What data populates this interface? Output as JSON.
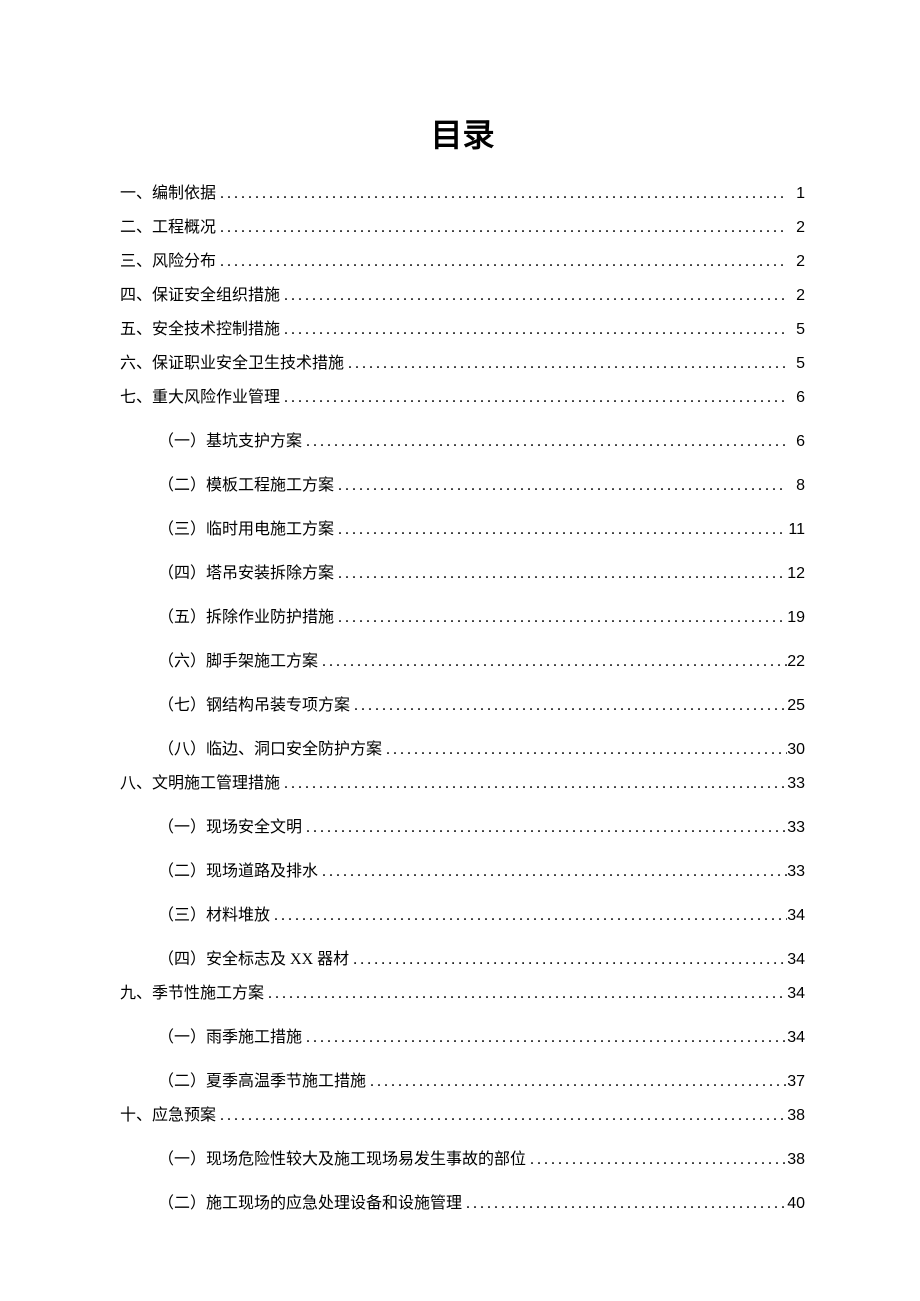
{
  "title": "目录",
  "toc": [
    {
      "level": 1,
      "num": "一、",
      "text": "编制依据",
      "page": "1"
    },
    {
      "level": 1,
      "num": "二、",
      "text": "工程概况",
      "page": "2"
    },
    {
      "level": 1,
      "num": "三、",
      "text": "风险分布",
      "page": "2"
    },
    {
      "level": 1,
      "num": "四、",
      "text": "保证安全组织措施",
      "page": "2"
    },
    {
      "level": 1,
      "num": "五、",
      "text": "安全技术控制措施",
      "page": "5"
    },
    {
      "level": 1,
      "num": "六、",
      "text": "保证职业安全卫生技术措施",
      "page": "5"
    },
    {
      "level": 1,
      "num": "七、",
      "text": "重大风险作业管理",
      "page": "6"
    },
    {
      "level": 2,
      "num": "（一）",
      "text": "基坑支护方案",
      "page": "6"
    },
    {
      "level": 2,
      "num": "（二）",
      "text": "模板工程施工方案",
      "page": "8"
    },
    {
      "level": 2,
      "num": "（三）",
      "text": "临时用电施工方案",
      "page": "11"
    },
    {
      "level": 2,
      "num": "（四）",
      "text": "塔吊安装拆除方案",
      "page": "12"
    },
    {
      "level": 2,
      "num": "（五）",
      "text": "拆除作业防护措施",
      "page": "19"
    },
    {
      "level": 2,
      "num": "（六）",
      "text": "脚手架施工方案",
      "page": "22"
    },
    {
      "level": 2,
      "num": "（七）",
      "text": "钢结构吊装专项方案",
      "page": "25"
    },
    {
      "level": 2,
      "num": "（八）",
      "text": "临边、洞口安全防护方案",
      "page": "30"
    },
    {
      "level": 1,
      "num": "八、",
      "text": "文明施工管理措施",
      "page": "33"
    },
    {
      "level": 2,
      "num": "（一）",
      "text": "现场安全文明",
      "page": "33"
    },
    {
      "level": 2,
      "num": "（二）",
      "text": "现场道路及排水",
      "page": "33"
    },
    {
      "level": 2,
      "num": "（三）",
      "text": "材料堆放",
      "page": "34"
    },
    {
      "level": 2,
      "num": "（四）",
      "text": "安全标志及 XX 器材",
      "page": "34"
    },
    {
      "level": 1,
      "num": "九、",
      "text": "季节性施工方案",
      "page": "34"
    },
    {
      "level": 2,
      "num": "（一）",
      "text": "雨季施工措施",
      "page": "34"
    },
    {
      "level": 2,
      "num": "（二）",
      "text": "夏季高温季节施工措施",
      "page": "37"
    },
    {
      "level": 1,
      "num": "十、",
      "text": "应急预案",
      "page": "38"
    },
    {
      "level": 2,
      "num": "（一）",
      "text": "现场危险性较大及施工现场易发生事故的部位",
      "page": "38"
    },
    {
      "level": 2,
      "num": "（二）",
      "text": "施工现场的应急处理设备和设施管理",
      "page": "40"
    }
  ]
}
